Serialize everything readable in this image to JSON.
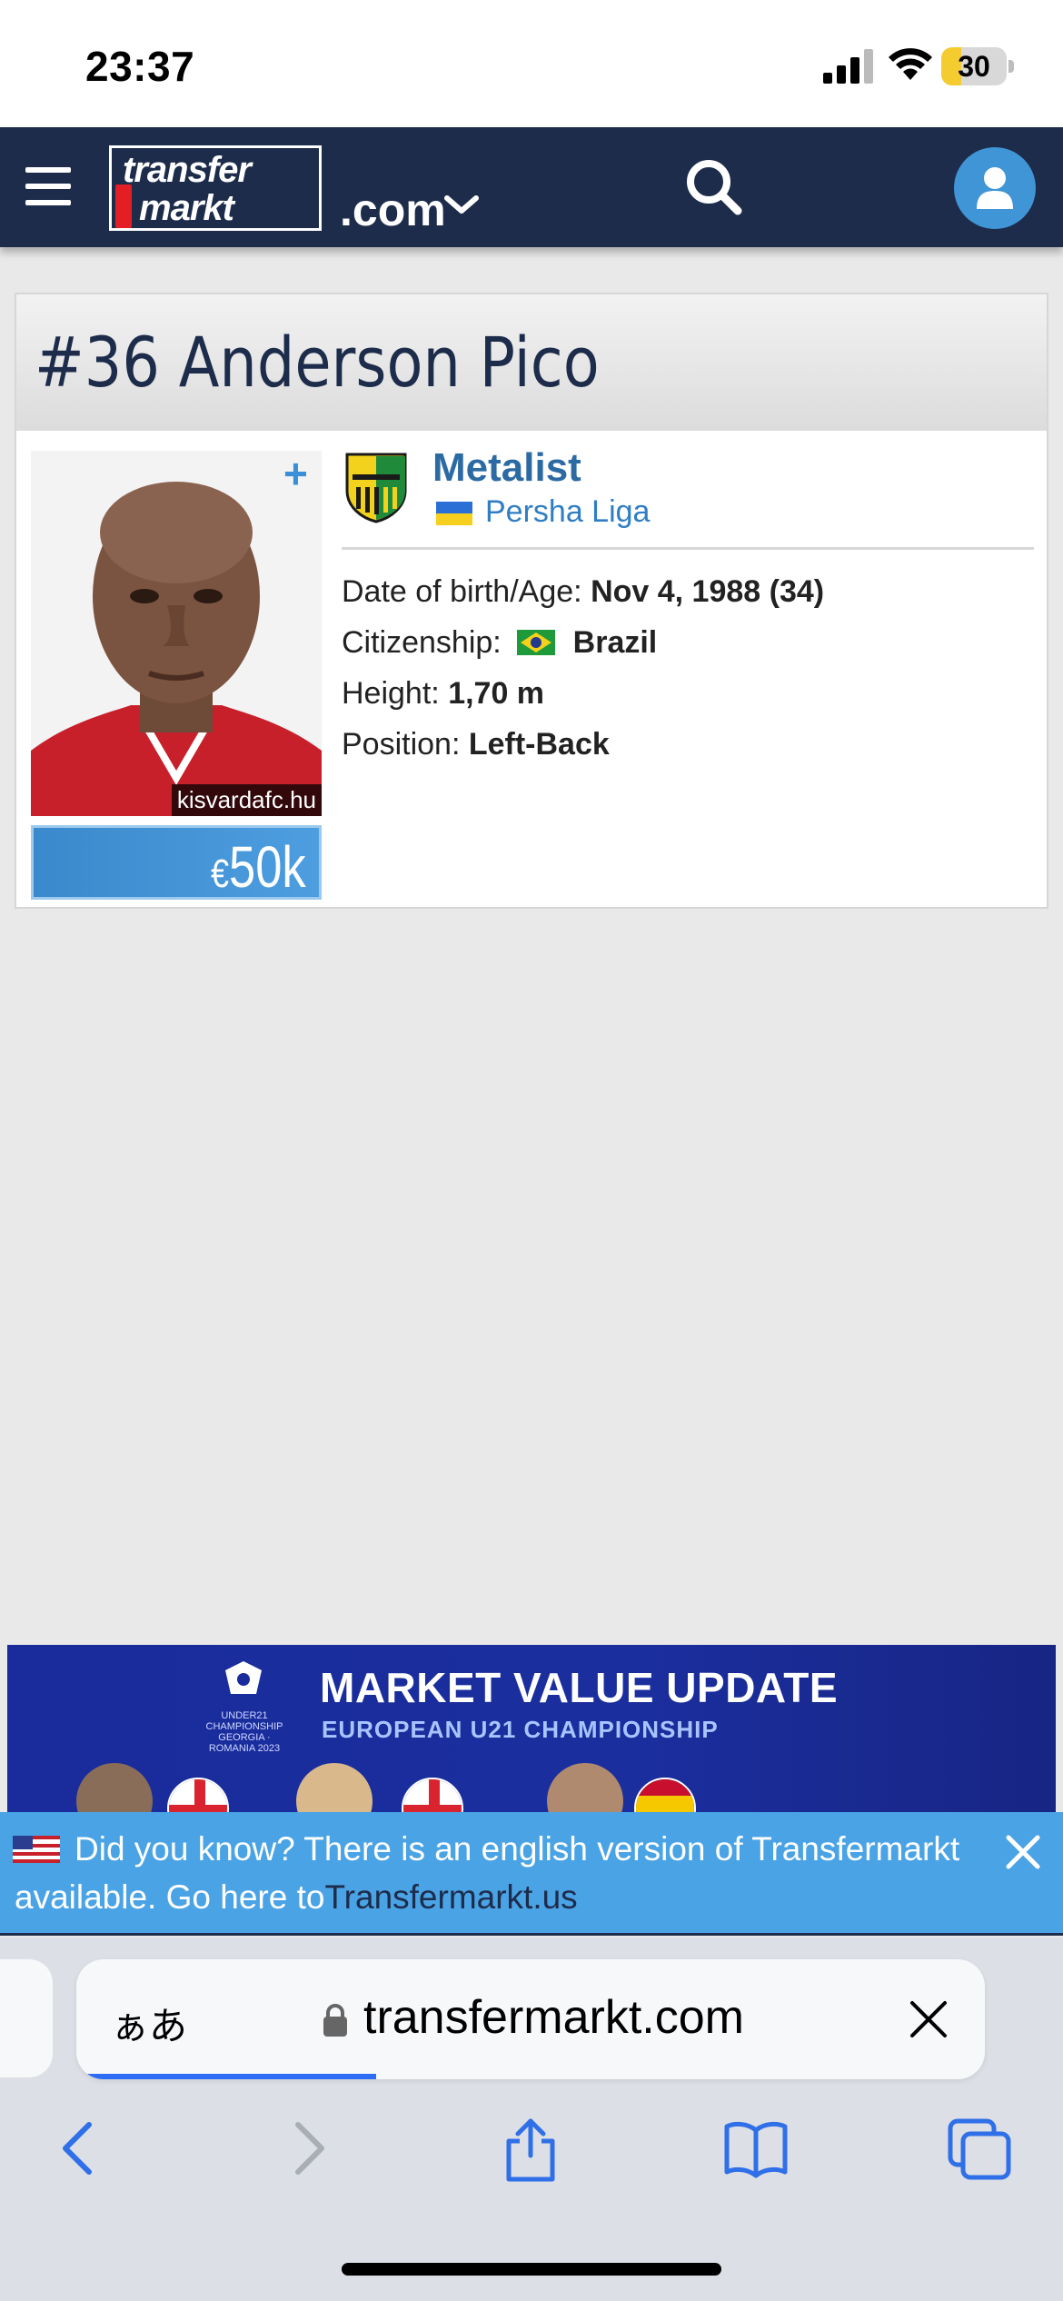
{
  "status": {
    "time": "23:37",
    "battery": "30",
    "battery_fraction": 0.3
  },
  "nav": {
    "logo_line1": "transfer",
    "logo_line2": "markt",
    "domain": ".com"
  },
  "player": {
    "title": "#36 Anderson Pico",
    "photo_credit": "kisvardafc.hu",
    "value_currency": "€",
    "value_amount": "50k",
    "club": "Metalist",
    "league": "Persha Liga",
    "dob_label": "Date of birth/Age:",
    "dob_value": "Nov 4, 1988 (34)",
    "citizenship_label": "Citizenship:",
    "citizenship_value": "Brazil",
    "height_label": "Height:",
    "height_value": "1,70 m",
    "position_label": "Position:",
    "position_value": "Left-Back"
  },
  "ad": {
    "title": "MARKET VALUE UPDATE",
    "subtitle": "EUROPEAN U21 CHAMPIONSHIP",
    "logo_text": "UNDER21 CHAMPIONSHIP GEORGIA · ROMANIA 2023"
  },
  "notice": {
    "text": "Did you know? There is an english version of Transfermarkt available. Go here to",
    "link": "Transfermarkt.us"
  },
  "browser": {
    "aa": "ぁあ",
    "url": "transfermarkt.com",
    "load_progress": 0.33
  },
  "colors": {
    "navbar": "#1d2c4b",
    "accent_blue": "#4aa3e5",
    "club_link": "#2c6aa3"
  }
}
